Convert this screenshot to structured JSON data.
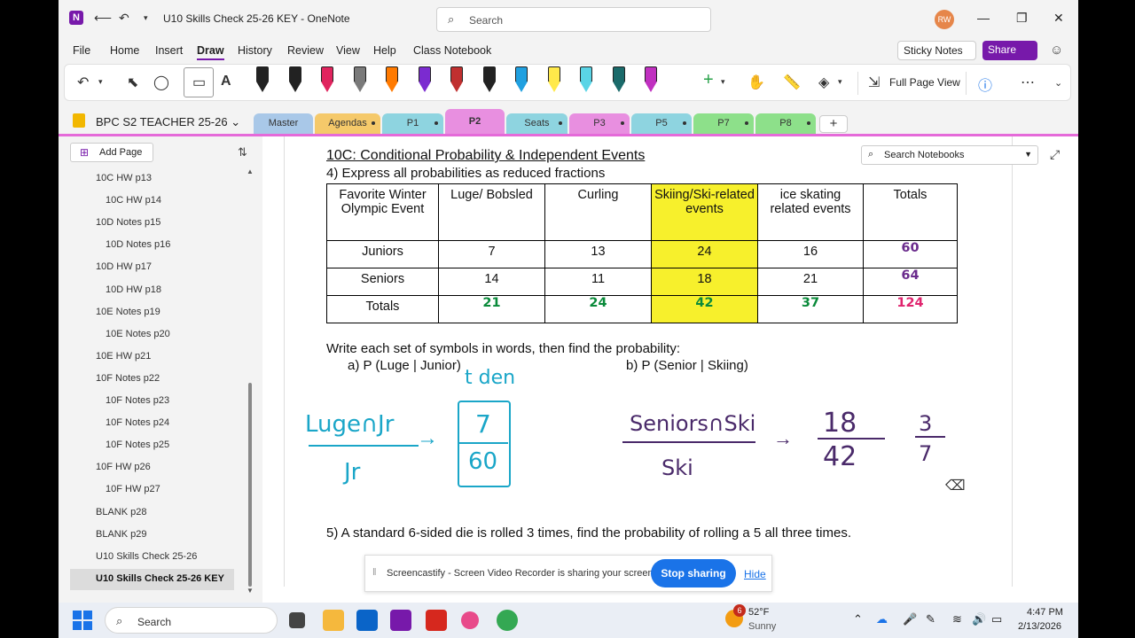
{
  "window": {
    "title": "U10 Skills Check 25-26 KEY  -  OneNote",
    "search_placeholder": "Search",
    "avatar_initials": "RW"
  },
  "menu": [
    "File",
    "Home",
    "Insert",
    "Draw",
    "History",
    "Review",
    "View",
    "Help",
    "Class Notebook"
  ],
  "menu_active": "Draw",
  "header_buttons": {
    "sticky_notes": "Sticky Notes",
    "share": "Share"
  },
  "ribbon": {
    "pen_colors": [
      "#222222",
      "#222222",
      "#e0245e",
      "#7a7a7a",
      "#ff7a00",
      "#7b2bd0",
      "#c03030",
      "#222222",
      "#20a0e0",
      "#ffe94a",
      "#5ad4e6",
      "#1a6a6a",
      "#c030c0"
    ],
    "full_page_view": "Full Page View"
  },
  "notebook": {
    "name": "BPC S2 TEACHER 25-26",
    "tabs": [
      {
        "label": "Master",
        "color": "#a9c8e8"
      },
      {
        "label": "Agendas",
        "color": "#f5c96a"
      },
      {
        "label": "P1",
        "color": "#8ed4e0"
      },
      {
        "label": "P2",
        "color": "#e88fe0"
      },
      {
        "label": "Seats",
        "color": "#8ed4e0"
      },
      {
        "label": "P3",
        "color": "#e88fe0"
      },
      {
        "label": "P5",
        "color": "#8ed4e0"
      },
      {
        "label": "P7",
        "color": "#8de08a"
      },
      {
        "label": "P8",
        "color": "#8de08a"
      }
    ],
    "active_tab": "P2"
  },
  "sidebar": {
    "add_page": "Add Page",
    "pages": [
      {
        "label": "10C HW p13",
        "indent": 0
      },
      {
        "label": "10C HW p14",
        "indent": 1
      },
      {
        "label": "10D Notes p15",
        "indent": 0
      },
      {
        "label": "10D Notes p16",
        "indent": 1
      },
      {
        "label": "10D HW p17",
        "indent": 0
      },
      {
        "label": "10D HW p18",
        "indent": 1
      },
      {
        "label": "10E Notes p19",
        "indent": 0
      },
      {
        "label": "10E Notes p20",
        "indent": 1
      },
      {
        "label": "10E HW p21",
        "indent": 0
      },
      {
        "label": "10F Notes p22",
        "indent": 0
      },
      {
        "label": "10F Notes p23",
        "indent": 1
      },
      {
        "label": "10F Notes p24",
        "indent": 1
      },
      {
        "label": "10F Notes p25",
        "indent": 1
      },
      {
        "label": "10F HW p26",
        "indent": 0
      },
      {
        "label": "10F HW p27",
        "indent": 1
      },
      {
        "label": "BLANK p28",
        "indent": 0
      },
      {
        "label": "BLANK p29",
        "indent": 0
      },
      {
        "label": "U10 Skills Check 25-26",
        "indent": 0
      },
      {
        "label": "U10 Skills Check 25-26 KEY",
        "indent": 0,
        "selected": true
      }
    ]
  },
  "page": {
    "search_notebooks": "Search Notebooks",
    "heading": "10C: Conditional Probability & Independent Events",
    "instruction": "4)  Express all probabilities as reduced fractions",
    "table": {
      "headers": [
        "Favorite Winter Olympic Event",
        "Luge/ Bobsled",
        "Curling",
        "Skiing/Ski-related events",
        "ice skating related events",
        "Totals"
      ],
      "rows": [
        {
          "label": "Juniors",
          "values": [
            "7",
            "13",
            "24",
            "16"
          ],
          "total": "60"
        },
        {
          "label": "Seniors",
          "values": [
            "14",
            "11",
            "18",
            "21"
          ],
          "total": "64"
        },
        {
          "label": "Totals",
          "values": [
            "21",
            "24",
            "42",
            "37"
          ],
          "total": "124"
        }
      ]
    },
    "prompt": "Write each set of symbols in words, then find the probability:",
    "part_a": "a)   P (Luge | Junior)",
    "part_b": "b)  P (Senior | Skiing)",
    "annotation_a": {
      "over": "Luge∩Jr",
      "under": "Jr",
      "note": "t den",
      "num": "7",
      "den": "60"
    },
    "annotation_b": {
      "over": "Seniors∩Ski",
      "under": "Ski",
      "num": "18",
      "den": "42",
      "reduced_num": "3",
      "reduced_den": "7"
    },
    "question5": "5) A standard 6-sided die is rolled 3 times, find the probability of rolling a 5 all three times."
  },
  "share_bar": {
    "message": "Screencastify - Screen Video Recorder is sharing your screen.",
    "stop": "Stop sharing",
    "hide": "Hide"
  },
  "taskbar": {
    "search": "Search",
    "weather_temp": "52°F",
    "weather_cond": "Sunny",
    "weather_badge": "6",
    "time": "4:47 PM",
    "date": "2/13/2026"
  }
}
